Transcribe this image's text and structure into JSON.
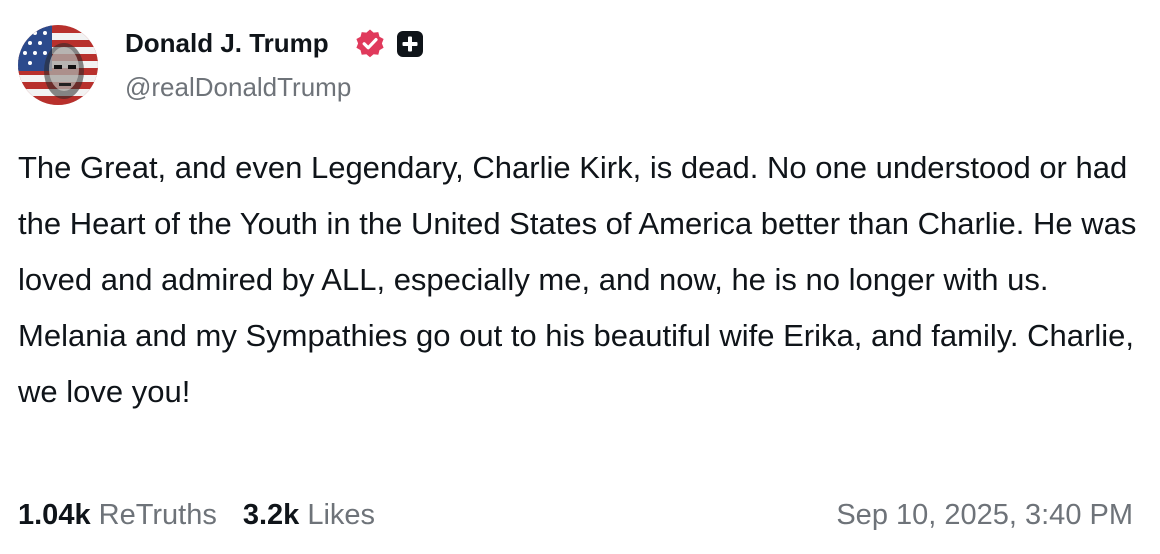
{
  "author": {
    "name": "Donald J. Trump",
    "handle": "@realDonaldTrump",
    "verified_icon": "verified-badge-icon",
    "plus_icon": "plus-square-icon",
    "colors": {
      "verified": "#e03a5c",
      "plus": "#0f1419"
    }
  },
  "post": {
    "text": "The Great, and even Legendary, Charlie Kirk, is dead. No one understood or had the Heart of the Youth in the United States of America better than Charlie. He was loved and admired by ALL, especially me, and now, he is no longer with us. Melania and my Sympathies go out to his beautiful wife Erika, and family. Charlie, we love you!"
  },
  "stats": {
    "retruths_count": "1.04k",
    "retruths_label": "ReTruths",
    "likes_count": "3.2k",
    "likes_label": "Likes"
  },
  "timestamp": "Sep 10, 2025, 3:40 PM",
  "colors": {
    "text": "#0f1419",
    "muted": "#6e7379",
    "background": "#ffffff"
  }
}
